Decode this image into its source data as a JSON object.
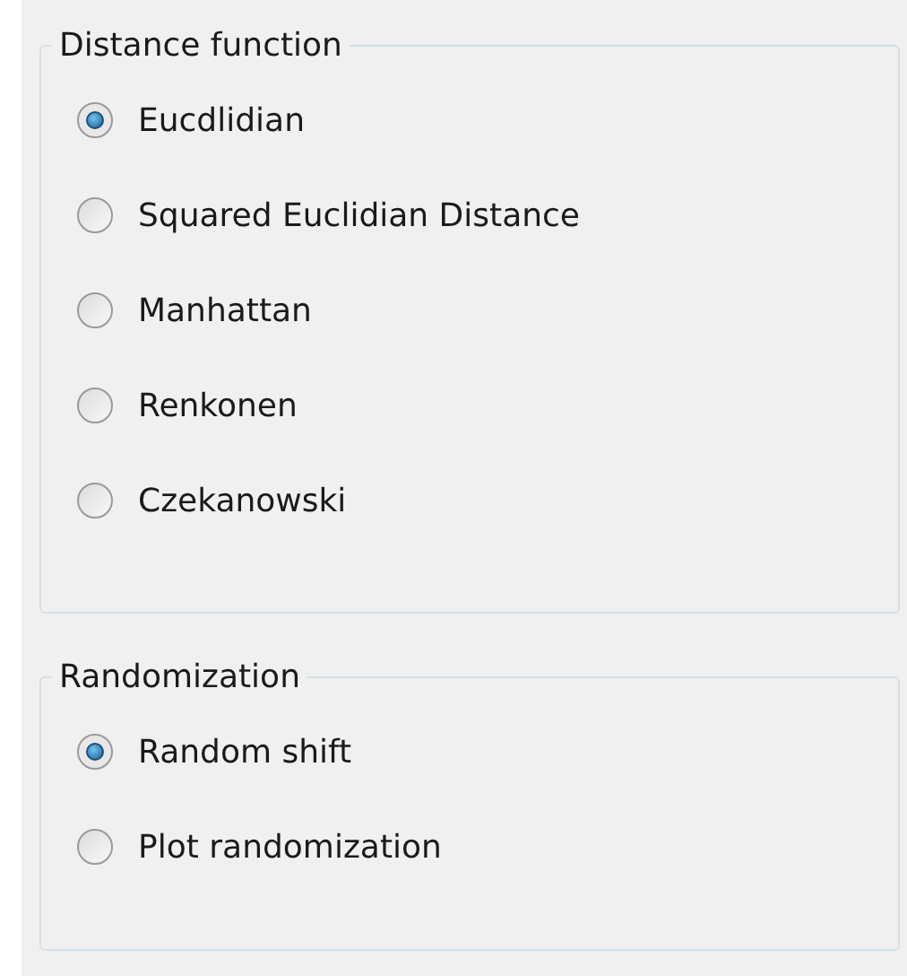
{
  "groups": [
    {
      "title": "Distance function",
      "options": [
        {
          "label": "Eucdlidian",
          "selected": true
        },
        {
          "label": "Squared Euclidian Distance",
          "selected": false
        },
        {
          "label": "Manhattan",
          "selected": false
        },
        {
          "label": "Renkonen",
          "selected": false
        },
        {
          "label": "Czekanowski",
          "selected": false
        }
      ]
    },
    {
      "title": "Randomization",
      "options": [
        {
          "label": "Random shift",
          "selected": true
        },
        {
          "label": "Plot randomization",
          "selected": false
        }
      ]
    }
  ]
}
